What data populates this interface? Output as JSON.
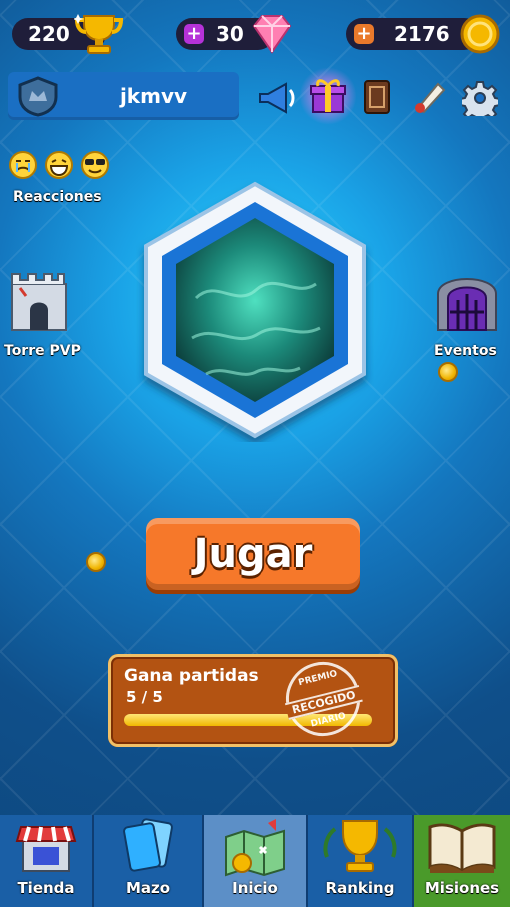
{
  "topbar": {
    "trophies": "220",
    "gems": "30",
    "gold": "2176",
    "trophy_icon": "trophy-icon",
    "gem_icon": "gem-icon",
    "coin_icon": "coin-icon"
  },
  "player": {
    "name": "jkmvv",
    "badge_icon": "crown-shield-icon"
  },
  "top_actions": [
    "megaphone-icon",
    "gift-icon",
    "card-deck-icon",
    "scroll-icon",
    "gear-icon"
  ],
  "side": {
    "reactions_label": "Reacciones",
    "tower_label": "Torre PVP",
    "events_label": "Eventos"
  },
  "play_button": "Jugar",
  "quest": {
    "title": "Gana partidas",
    "progress_text": "5 / 5",
    "progress": 1.0,
    "stamp_top": "PREMIO",
    "stamp_mid": "RECOGIDO",
    "stamp_bottom": "DIARIO"
  },
  "nav": {
    "items": [
      {
        "label": "Tienda",
        "icon": "shop-icon"
      },
      {
        "label": "Mazo",
        "icon": "cards-icon"
      },
      {
        "label": "Inicio",
        "icon": "map-icon"
      },
      {
        "label": "Ranking",
        "icon": "trophy-icon"
      },
      {
        "label": "Misiones",
        "icon": "book-icon"
      }
    ],
    "active": "Inicio"
  },
  "colors": {
    "accent_orange": "#f6782a",
    "nav_blue": "#1a5fa6",
    "missions_green": "#4a9a2a"
  }
}
